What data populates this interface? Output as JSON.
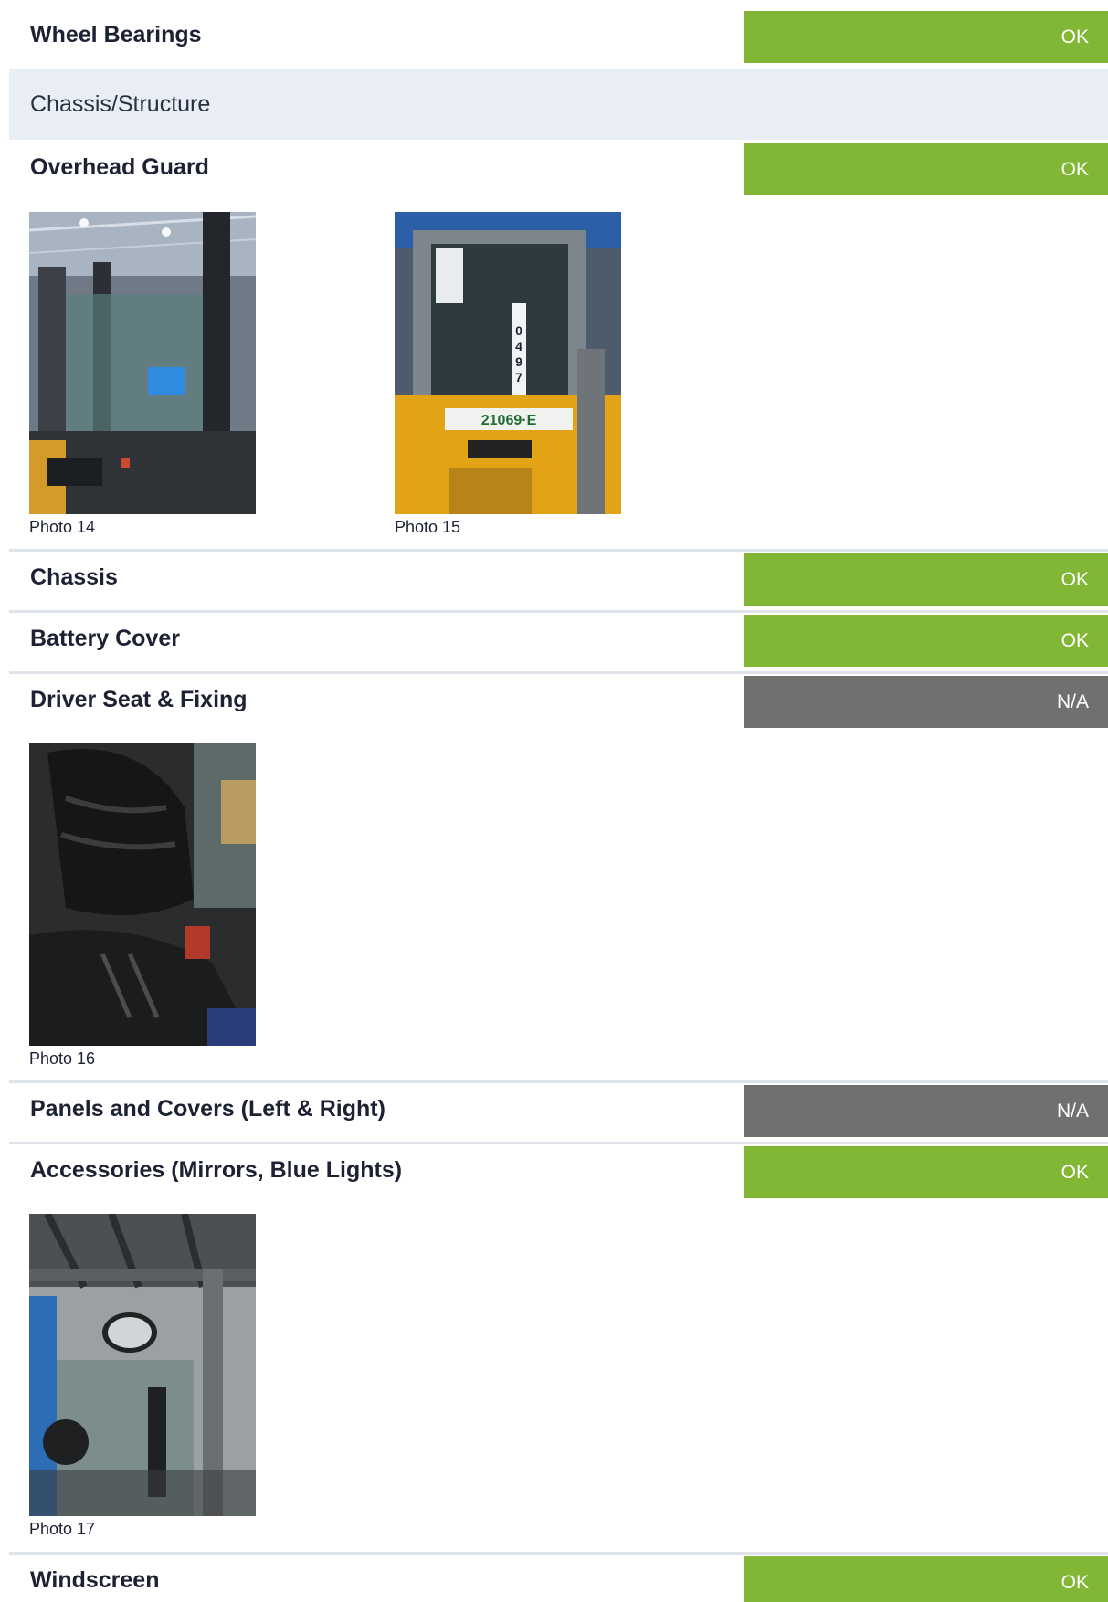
{
  "colors": {
    "ok": "#82b735",
    "na": "#707070",
    "section_bg": "#e8edf6",
    "separator": "#dfe3ea"
  },
  "items": {
    "wheel_bearings": {
      "label": "Wheel Bearings",
      "status": "OK"
    },
    "overhead_guard": {
      "label": "Overhead Guard",
      "status": "OK"
    },
    "chassis": {
      "label": "Chassis",
      "status": "OK"
    },
    "battery_cover": {
      "label": "Battery Cover",
      "status": "OK"
    },
    "driver_seat": {
      "label": "Driver Seat & Fixing",
      "status": "N/A"
    },
    "panels_covers": {
      "label": "Panels and Covers (Left & Right)",
      "status": "N/A"
    },
    "accessories": {
      "label": "Accessories (Mirrors, Blue Lights)",
      "status": "OK"
    },
    "windscreen": {
      "label": "Windscreen",
      "status": "OK"
    }
  },
  "section": {
    "label": "Chassis/Structure"
  },
  "photos": {
    "p14": {
      "caption": "Photo 14",
      "subject": "forklift-cab-interior-photo"
    },
    "p15": {
      "caption": "Photo 15",
      "subject": "forklift-rear-photo",
      "plate": "21069·E",
      "tag": "0497"
    },
    "p16": {
      "caption": "Photo 16",
      "subject": "driver-seat-photo"
    },
    "p17": {
      "caption": "Photo 17",
      "subject": "mirror-overhead-guard-photo"
    }
  }
}
